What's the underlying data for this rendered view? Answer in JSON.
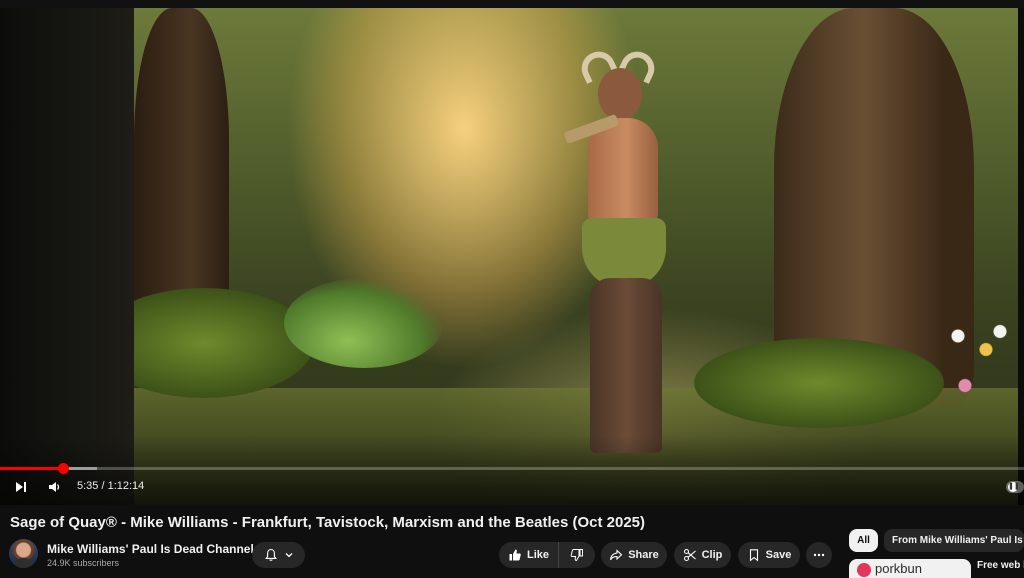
{
  "player": {
    "current_time": "5:35",
    "duration": "1:12:14",
    "time_display": "5:35 / 1:12:14",
    "played_fraction": 0.062,
    "loaded_fraction": 0.095,
    "autoplay_on": true,
    "icons": [
      "next-icon",
      "volume-icon",
      "autoplay-toggle"
    ]
  },
  "video": {
    "title": "Sage of Quay® - Mike Williams - Frankfurt, Tavistock, Marxism and the Beatles (Oct 2025)"
  },
  "channel": {
    "name": "Mike Williams' Paul Is Dead Channel",
    "subscribers": "24.9K subscribers"
  },
  "actions": {
    "like_label": "Like",
    "share_label": "Share",
    "clip_label": "Clip",
    "save_label": "Save"
  },
  "chips": {
    "all": "All",
    "from_channel": "From Mike Williams' Paul Is D"
  },
  "ad": {
    "brand": "porkbun",
    "side_text": "Free web h"
  },
  "colors": {
    "progress": "#ff0000",
    "background": "#0f0f0f",
    "pill": "#272727",
    "chip_active": "#f1f1f1"
  }
}
